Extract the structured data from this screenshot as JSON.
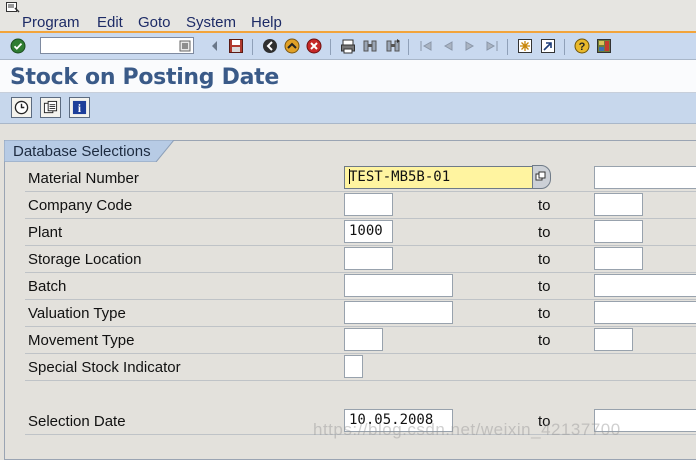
{
  "menu": [
    "Program",
    "Edit",
    "Goto",
    "System",
    "Help"
  ],
  "command_field": {
    "value": ""
  },
  "toolbar_icons": [
    "enter-icon",
    "back-icon",
    "save-icon",
    "back-nav-icon",
    "exit-icon",
    "cancel-icon",
    "print-icon",
    "find-icon",
    "find-next-icon",
    "first-page-icon",
    "previous-page-icon",
    "next-page-icon",
    "last-page-icon",
    "create-session-icon",
    "shortcut-icon",
    "help-icon",
    "layout-icon"
  ],
  "title": "Stock on Posting Date",
  "app_toolbar": [
    "execute-icon",
    "get-variant-icon",
    "program-info-icon"
  ],
  "section": {
    "title": "Database Selections"
  },
  "fields": [
    {
      "label": "Material Number",
      "low": "TEST-MB5B-01",
      "to": "",
      "high": ""
    },
    {
      "label": "Company Code",
      "low": "",
      "to": "to",
      "high": ""
    },
    {
      "label": "Plant",
      "low": "1000",
      "to": "to",
      "high": ""
    },
    {
      "label": "Storage Location",
      "low": "",
      "to": "to",
      "high": ""
    },
    {
      "label": "Batch",
      "low": "",
      "to": "to",
      "high": ""
    },
    {
      "label": "Valuation Type",
      "low": "",
      "to": "to",
      "high": ""
    },
    {
      "label": "Movement Type",
      "low": "",
      "to": "to",
      "high": ""
    },
    {
      "label": "Special Stock Indicator",
      "low": ""
    },
    {
      "label": "Selection Date",
      "low": "10.05.2008",
      "to": "to",
      "high": ""
    }
  ],
  "watermark": "https://blog.csdn.net/weixin_42137700"
}
